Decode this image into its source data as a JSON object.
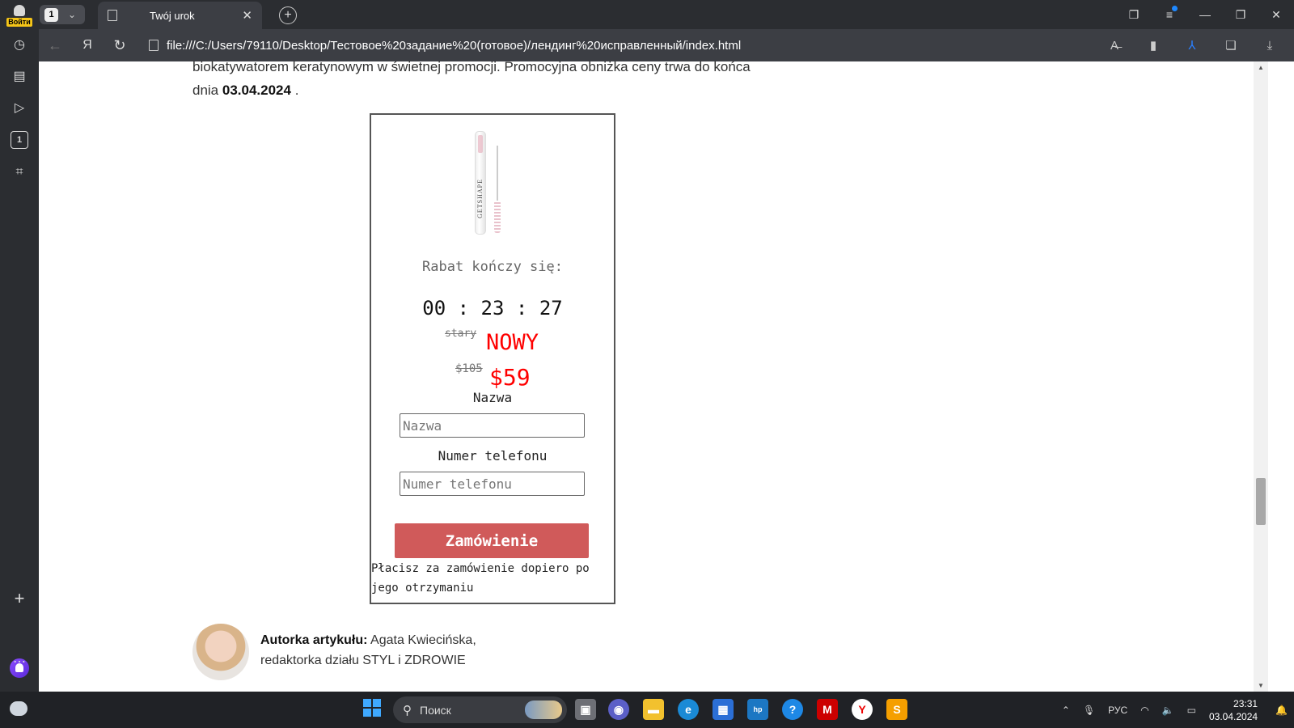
{
  "browser": {
    "login_label": "Войти",
    "tab_count": "1",
    "tab_title": "Twój urok",
    "url": "file:///C:/Users/79110/Desktop/Тестовое%20задание%20(готовое)/лендинг%20исправленный/index.html",
    "sidebar_tab_number": "1"
  },
  "article": {
    "intro_line1": "biokatywatorem keratynowym w świetnej promocji. Promocyjna obniżka ceny trwa do końca",
    "intro_line2_prefix": "dnia",
    "promo_date": "03.04.2024",
    "intro_line2_suffix": "."
  },
  "order_card": {
    "product_brand": "GETSHAPE",
    "discount_label": "Rabat kończy się:",
    "timer": {
      "hours": "00",
      "minutes": "23",
      "seconds": "27",
      "separator": ":"
    },
    "old_label": "stary",
    "new_label": "NOWY",
    "old_price": "$105",
    "new_price": "$59",
    "name_label": "Nazwa",
    "name_placeholder": "Nazwa",
    "phone_label": "Numer telefonu",
    "phone_placeholder": "Numer telefonu",
    "submit_label": "Zamówienie",
    "payment_note": "Płacisz za zamówienie dopiero po jego otrzymaniu"
  },
  "author": {
    "prefix": "Autorka artykułu:",
    "name": "Agata Kwiecińska,",
    "role": "redaktorka działu STYL i ZDROWIE"
  },
  "taskbar": {
    "search_placeholder": "Поиск",
    "language": "РУС",
    "time": "23:31",
    "date": "03.04.2024"
  },
  "colors": {
    "accent_red": "#ff0000",
    "submit_bg": "#d05a5a"
  }
}
